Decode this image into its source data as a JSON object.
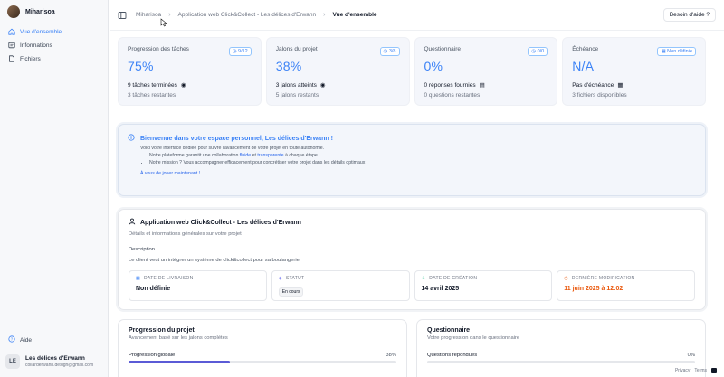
{
  "sidebar": {
    "brand": "Miharisoa",
    "items": [
      {
        "label": "Vue d'ensemble",
        "icon": "home-icon",
        "active": true
      },
      {
        "label": "Informations",
        "icon": "info-box-icon",
        "active": false
      },
      {
        "label": "Fichiers",
        "icon": "file-icon",
        "active": false
      }
    ],
    "help_label": "Aide",
    "user": {
      "initials": "LE",
      "name": "Les délices d'Erwann",
      "email": "collarderwann.design@gmail.com"
    }
  },
  "header": {
    "breadcrumb": [
      "Miharisoa",
      "Application web Click&Collect - Les délices d'Erwann",
      "Vue d'ensemble"
    ],
    "help_button": "Besoin d'aide ?"
  },
  "stats": [
    {
      "title": "Progression des tâches",
      "badge": "9/12",
      "value": "75%",
      "line1": "9 tâches terminées",
      "line2": "3 tâches restantes"
    },
    {
      "title": "Jalons du projet",
      "badge": "3/8",
      "value": "38%",
      "line1": "3 jalons atteints",
      "line2": "5 jalons restants"
    },
    {
      "title": "Questionnaire",
      "badge": "0/0",
      "value": "0%",
      "line1": "0 réponses fournies",
      "line2": "0 questions restantes"
    },
    {
      "title": "Échéance",
      "badge": "Non définie",
      "value": "N/A",
      "line1": "Pas d'échéance",
      "line2": "3 fichiers disponibles"
    }
  ],
  "welcome": {
    "title": "Bienvenue dans votre espace personnel, Les délices d'Erwann !",
    "subtitle": "Voici votre interface dédiée pour suivre l'avancement de votre projet en toute autonomie.",
    "bullet1_pre": "Notre plateforme garantit une collaboration ",
    "bullet1_hl1": "fluide",
    "bullet1_mid": " et ",
    "bullet1_hl2": "transparente",
    "bullet1_post": " à chaque étape.",
    "bullet2": "Notre mission ? Vous accompagner efficacement pour concrétiser votre projet dans les détails optimaux !",
    "link": "À vous de jouer maintenant !"
  },
  "project": {
    "title": "Application web Click&Collect - Les délices d'Erwann",
    "subtitle": "Détails et informations générales sur votre projet",
    "description_label": "Description",
    "description": "Le client veut un intégrer un système de click&collect pour sa boulangerie",
    "fields": [
      {
        "label": "DATE DE LIVRAISON",
        "value": "Non définie"
      },
      {
        "label": "STATUT",
        "value": "En cours"
      },
      {
        "label": "DATE DE CRÉATION",
        "value": "14 avril 2025"
      },
      {
        "label": "DERNIÈRE MODIFICATION",
        "value": "11 juin 2025 à 12:02"
      }
    ]
  },
  "progress_card": {
    "title": "Progression du projet",
    "subtitle": "Avancement basé sur les jalons complétés",
    "row_label": "Progression globale",
    "row_pct": "38%",
    "fraction": 0.38
  },
  "questionnaire_card": {
    "title": "Questionnaire",
    "subtitle": "Votre progression dans le questionnaire",
    "row_label": "Questions répondues",
    "row_pct": "0%",
    "fraction": 0
  },
  "footer": {
    "privacy": "Privacy",
    "terms": "Terms"
  },
  "colors": {
    "accent": "#3b82f6",
    "orange": "#ea580c",
    "bar": "#5b5bd6"
  }
}
